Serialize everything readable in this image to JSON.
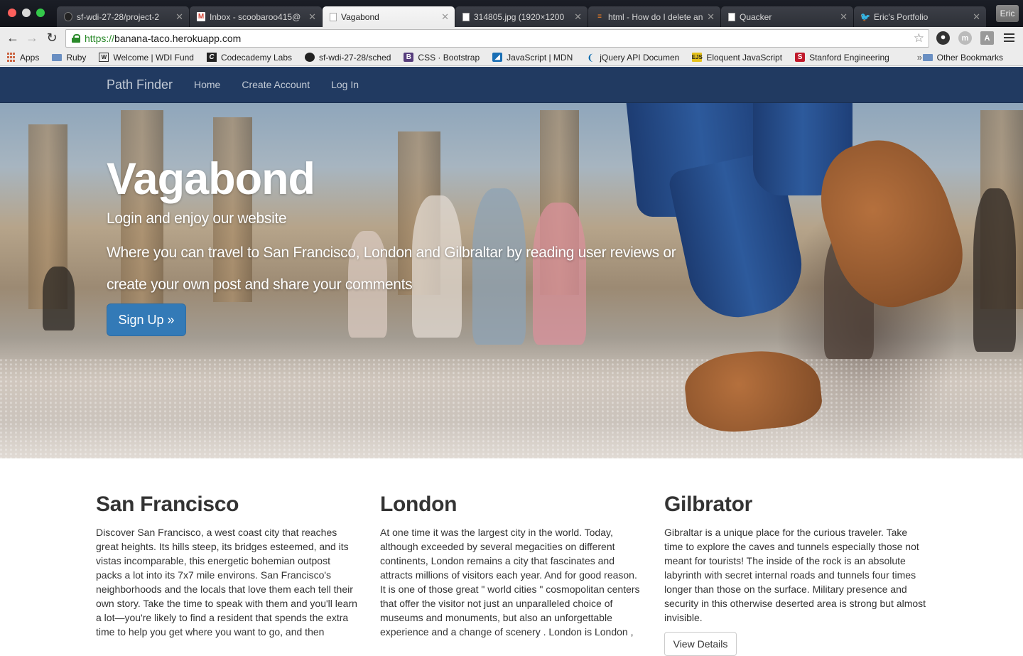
{
  "browser": {
    "tabs": [
      {
        "label": "sf-wdi-27-28/project-2",
        "icon": "github-icon",
        "active": false
      },
      {
        "label": "Inbox - scoobaroo415@",
        "icon": "gmail-icon",
        "active": false
      },
      {
        "label": "Vagabond",
        "icon": "document-icon",
        "active": true
      },
      {
        "label": "314805.jpg (1920×1200",
        "icon": "document-icon",
        "active": false
      },
      {
        "label": "html - How do I delete an",
        "icon": "stackoverflow-icon",
        "active": false
      },
      {
        "label": "Quacker",
        "icon": "document-icon",
        "active": false
      },
      {
        "label": "Eric's Portfolio",
        "icon": "twitter-icon",
        "active": false
      }
    ],
    "profile_name": "Eric",
    "url_scheme": "https://",
    "url_host": "banana-taco.herokuapp.com",
    "bookmarks": [
      {
        "label": "Apps",
        "icon": "apps-grid-icon"
      },
      {
        "label": "Ruby",
        "icon": "folder-icon"
      },
      {
        "label": "Welcome | WDI Fund",
        "icon": "book-icon"
      },
      {
        "label": "Codecademy Labs",
        "icon": "codecademy-icon"
      },
      {
        "label": "sf-wdi-27-28/sched",
        "icon": "github-icon"
      },
      {
        "label": "CSS · Bootstrap",
        "icon": "bootstrap-icon"
      },
      {
        "label": "JavaScript | MDN",
        "icon": "mdn-icon"
      },
      {
        "label": "jQuery API Documen",
        "icon": "jquery-icon"
      },
      {
        "label": "Eloquent JavaScript",
        "icon": "ejs-icon"
      },
      {
        "label": "Stanford Engineering",
        "icon": "stanford-icon"
      }
    ],
    "bookmarks_more": "»",
    "other_bookmarks": "Other Bookmarks"
  },
  "site": {
    "brand": "Path Finder",
    "nav": [
      "Home",
      "Create Account",
      "Log In"
    ],
    "hero": {
      "title": "Vagabond",
      "subtitle": "Login and enjoy our website",
      "description": "Where you can travel to San Francisco, London and Gilbraltar by reading user reviews or create your own post and share your comments",
      "button": "Sign Up »"
    },
    "cities": [
      {
        "name": "San Francisco",
        "text": "Discover San Francisco, a west coast city that reaches great heights. Its hills steep, its bridges esteemed, and its vistas incomparable, this energetic bohemian outpost packs a lot into its 7x7 mile environs. San Francisco's neighborhoods and the locals that love them each tell their own story. Take the time to speak with them and you'll learn a lot—you're likely to find a resident that spends the extra time to help you get where you want to go, and then"
      },
      {
        "name": "London",
        "text": "At one time it was the largest city in the world. Today, although exceeded by several megacities on different continents, London remains a city that fascinates and attracts millions of visitors each year. And for good reason. It is one of those great \" world cities \" cosmopolitan centers that offer the visitor not just an unparalleled choice of museums and monuments, but also an unforgettable experience and a change of scenery . London is London ,"
      },
      {
        "name": "Gilbrator",
        "text": "Gibraltar is a unique place for the curious traveler. Take time to explore the caves and tunnels especially those not meant for tourists! The inside of the rock is an absolute labyrinth with secret internal roads and tunnels four times longer than those on the surface. Military presence and security in this otherwise deserted area is strong but almost invisible.",
        "button": "View Details"
      }
    ]
  }
}
